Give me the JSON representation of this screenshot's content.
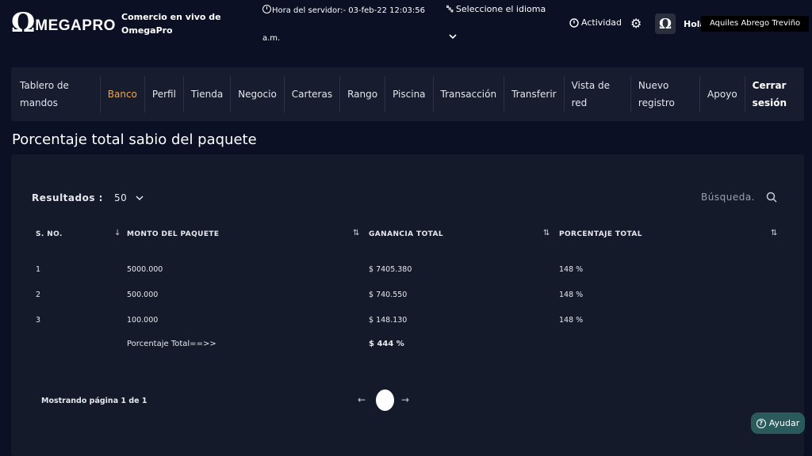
{
  "header": {
    "logo_omega": "Ω",
    "logo_text": "MEGAPRO",
    "tagline": "Comercio en vivo de OmegaPro",
    "server_time_line1": "Hora del servidor:- 03-feb-22 12:03:56",
    "server_time_line2": "a.m.",
    "language_label": "Seleccione el idioma",
    "activity_label": "Actividad",
    "greeting": "Hola",
    "username": "Aquiles Abrego Treviño",
    "avatar_glyph": "Ω"
  },
  "nav": {
    "items": [
      {
        "label": "Tablero de mandos"
      },
      {
        "label": "Banco"
      },
      {
        "label": "Perfil"
      },
      {
        "label": "Tienda"
      },
      {
        "label": "Negocio"
      },
      {
        "label": "Carteras"
      },
      {
        "label": "Rango"
      },
      {
        "label": "Piscina"
      },
      {
        "label": "Transacción"
      },
      {
        "label": "Transferir"
      },
      {
        "label": "Vista de red"
      },
      {
        "label": "Nuevo registro"
      },
      {
        "label": "Apoyo"
      },
      {
        "label": "Cerrar sesión"
      }
    ]
  },
  "page": {
    "title": "Porcentaje total sabio del paquete"
  },
  "table_controls": {
    "results_label": "Resultados :",
    "results_value": "50",
    "search_placeholder": "Búsqueda."
  },
  "table": {
    "headers": [
      "S. NO.",
      "MONTO DEL PAQUETE",
      "GANANCIA TOTAL",
      "PORCENTAJE TOTAL"
    ],
    "rows": [
      [
        "1",
        "5000.000",
        "$ 7405.380",
        "148 %"
      ],
      [
        "2",
        "500.000",
        "$ 740.550",
        "148 %"
      ],
      [
        "3",
        "100.000",
        "$ 148.130",
        "148 %"
      ]
    ],
    "total_label": "Porcentaje Total==>>",
    "total_value": "$ 444 %"
  },
  "pagination": {
    "showing": "Mostrando página 1 de 1"
  },
  "help": {
    "label": "Ayudar"
  },
  "colors": {
    "background": "#0b1024",
    "nav_bg": "#171c2e",
    "card_bg": "#151a2b",
    "active_nav": "#f0a64a",
    "help_bg": "#2a5a5c"
  }
}
